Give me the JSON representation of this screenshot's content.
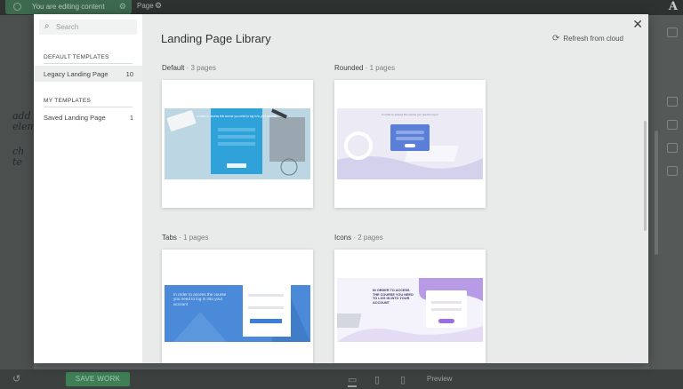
{
  "editor": {
    "editing_status": "You are editing content",
    "page_tab": "Page",
    "save_button": "SAVE WORK",
    "preview": "Preview",
    "sidebar_notes": [
      "add",
      "eleme",
      "ch",
      "te"
    ],
    "colors": {
      "save_green": "#3e7f56",
      "topbar": "#2e3331"
    }
  },
  "modal": {
    "title": "Landing Page Library",
    "refresh_label": "Refresh from cloud",
    "search_placeholder": "Search",
    "default_section": "DEFAULT TEMPLATES",
    "my_section": "MY TEMPLATES",
    "default_templates": [
      {
        "label": "Legacy Landing Page",
        "count": "10"
      }
    ],
    "my_templates": [
      {
        "label": "Saved Landing Page",
        "count": "1"
      }
    ]
  },
  "cards": [
    {
      "name": "Default",
      "pages": "3 pages",
      "thumb_text": "In order to access this course you need to log in to your account"
    },
    {
      "name": "Rounded",
      "pages": "1 pages",
      "thumb_text": "In order to access this course you need to log in"
    },
    {
      "name": "Tabs",
      "pages": "1 pages",
      "thumb_text": "In order to access the course you need to log in into your account"
    },
    {
      "name": "Icons",
      "pages": "2 pages",
      "thumb_text": "IN ORDER TO ACCESS THE COURSE YOU NEED TO LOG IN INTO YOUR ACCOUNT"
    }
  ]
}
